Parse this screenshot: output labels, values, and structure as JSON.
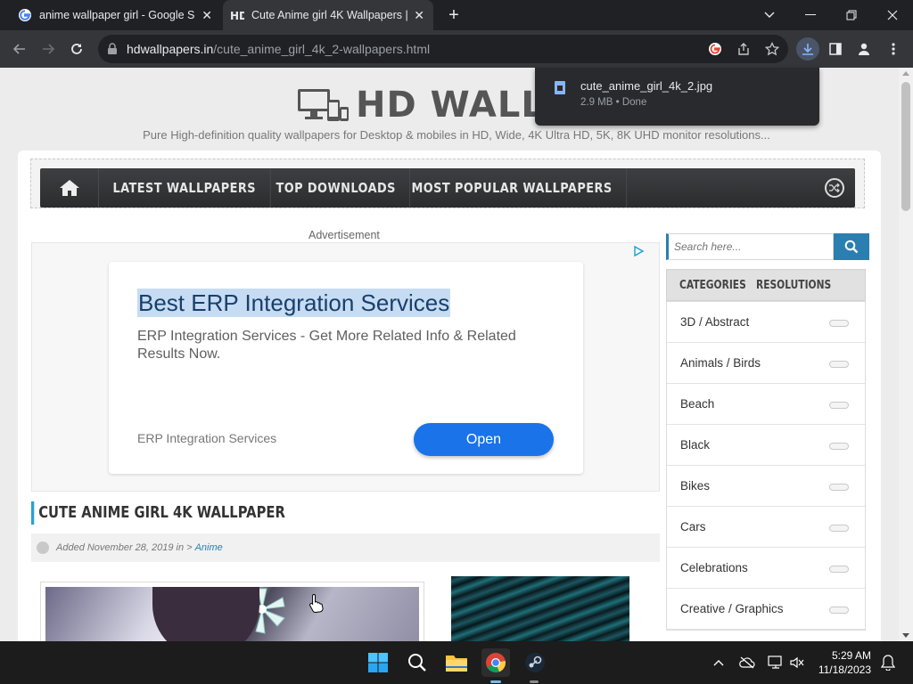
{
  "browser": {
    "tabs": [
      {
        "title": "anime wallpaper girl - Google Se",
        "favicon": "google-g-icon",
        "active": false
      },
      {
        "title": "Cute Anime girl 4K Wallpapers | H",
        "favicon": "hd-wallpapers-icon",
        "active": true
      }
    ],
    "url_domain": "hdwallpapers.in",
    "url_path": "/cute_anime_girl_4k_2-wallpapers.html"
  },
  "download": {
    "filename": "cute_anime_girl_4k_2.jpg",
    "status": "2.9 MB • Done"
  },
  "site": {
    "logo_text": "HD WALLPAPERS",
    "tagline": "Pure High-definition quality wallpapers for Desktop & mobiles in HD, Wide, 4K Ultra HD, 5K, 8K UHD monitor resolutions...",
    "nav": [
      "LATEST WALLPAPERS",
      "TOP DOWNLOADS",
      "MOST POPULAR WALLPAPERS"
    ],
    "ad": {
      "label": "Advertisement",
      "title": "Best ERP Integration Services",
      "description": "ERP Integration Services - Get More Related Info & Related Results Now.",
      "footer": "ERP Integration Services",
      "button": "Open"
    },
    "post": {
      "title": "CUTE ANIME GIRL 4K WALLPAPER",
      "meta_prefix": "Added November 28, 2019 in >",
      "meta_category": "Anime"
    },
    "sidebar": {
      "search_placeholder": "Search here...",
      "tabs": [
        "CATEGORIES",
        "RESOLUTIONS"
      ],
      "categories": [
        "3D / Abstract",
        "Animals / Birds",
        "Beach",
        "Black",
        "Bikes",
        "Cars",
        "Celebrations",
        "Creative / Graphics"
      ]
    }
  },
  "taskbar": {
    "time": "5:29 AM",
    "date": "11/18/2023"
  },
  "colors": {
    "accent": "#2a7fb0",
    "ad_button": "#1a73e8",
    "chrome_dark": "#202124"
  }
}
